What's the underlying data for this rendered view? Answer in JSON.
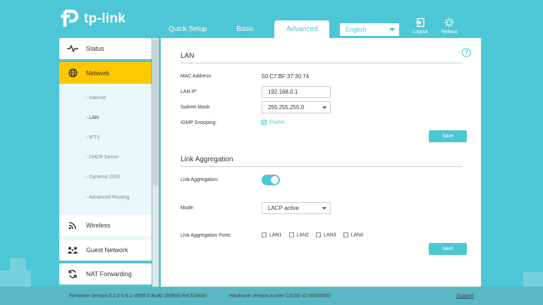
{
  "brand": {
    "name": "tp-link"
  },
  "nav": {
    "tabs": [
      {
        "label": "Quick Setup"
      },
      {
        "label": "Basic"
      },
      {
        "label": "Advanced"
      }
    ],
    "language": "English",
    "logout_label": "Logout",
    "reboot_label": "Reboot"
  },
  "sidebar": {
    "items": [
      {
        "label": "Status",
        "icon": "pulse-icon"
      },
      {
        "label": "Network",
        "icon": "globe-icon"
      },
      {
        "label": "Wireless",
        "icon": "wifi-icon"
      },
      {
        "label": "Guest Network",
        "icon": "guest-icon"
      },
      {
        "label": "NAT Forwarding",
        "icon": "nat-icon"
      }
    ],
    "subitems": [
      {
        "label": "- Internet"
      },
      {
        "label": "- LAN"
      },
      {
        "label": "- IPTV"
      },
      {
        "label": "- DHCP Server"
      },
      {
        "label": "- Dynamic DNS"
      },
      {
        "label": "- Advanced Routing"
      }
    ]
  },
  "lan": {
    "title": "LAN",
    "mac_label": "MAC Address:",
    "mac_value": "50:C7:BF:37:30:74",
    "ip_label": "LAN IP:",
    "ip_value": "192.168.0.1",
    "subnet_label": "Subnet Mask:",
    "subnet_value": "255.255.255.0",
    "igmp_label": "IGMP Snooping:",
    "igmp_enable_label": "Enable",
    "igmp_checked": true,
    "save_label": "Save"
  },
  "link_agg": {
    "title": "Link Aggregation",
    "toggle_label": "Link Aggregation:",
    "toggle_on": true,
    "mode_label": "Mode:",
    "mode_value": "LACP active",
    "ports_label": "Link Aggregation Ports:",
    "ports": [
      {
        "label": "LAN1"
      },
      {
        "label": "LAN2"
      },
      {
        "label": "LAN3"
      },
      {
        "label": "LAN4"
      }
    ],
    "save_label": "Save"
  },
  "footer": {
    "firmware": "Firmware Version:0.2.0 0.9.1 v006f.0 Build 160908 Rel.51843n",
    "hardware": "Hardware Version:Archer C3150 v2 00000000",
    "support": "Support"
  },
  "colors": {
    "accent": "#4dc6d6",
    "active_menu": "#ffc800"
  }
}
